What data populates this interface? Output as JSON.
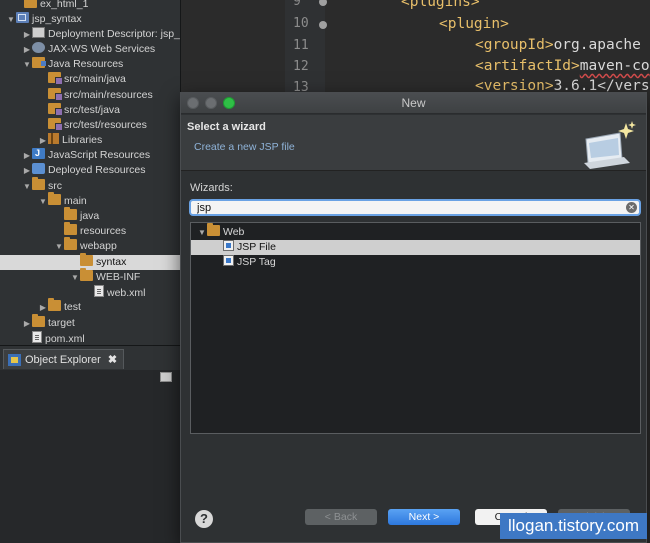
{
  "project_tree": [
    {
      "label": "ex_html_1",
      "icon": "project-icon",
      "arrow": ""
    },
    {
      "label": "jsp_syntax",
      "icon": "project-icon",
      "arrow": "▼"
    },
    {
      "label": "Deployment Descriptor: jsp_syntax",
      "icon": "deployment-descriptor-icon",
      "arrow": "▶"
    },
    {
      "label": "JAX-WS Web Services",
      "icon": "web-services-icon",
      "arrow": "▶"
    },
    {
      "label": "Java Resources",
      "icon": "java-resources-icon",
      "arrow": "▼"
    },
    {
      "label": "src/main/java",
      "icon": "source-folder-icon",
      "arrow": ""
    },
    {
      "label": "src/main/resources",
      "icon": "source-folder-icon",
      "arrow": ""
    },
    {
      "label": "src/test/java",
      "icon": "source-folder-icon",
      "arrow": ""
    },
    {
      "label": "src/test/resources",
      "icon": "source-folder-icon",
      "arrow": ""
    },
    {
      "label": "Libraries",
      "icon": "libraries-icon",
      "arrow": "▶"
    },
    {
      "label": "JavaScript Resources",
      "icon": "javascript-resources-icon",
      "arrow": "▶"
    },
    {
      "label": "Deployed Resources",
      "icon": "deployed-resources-icon",
      "arrow": "▶"
    },
    {
      "label": "src",
      "icon": "folder-icon",
      "arrow": "▼"
    },
    {
      "label": "main",
      "icon": "folder-icon",
      "arrow": "▼"
    },
    {
      "label": "java",
      "icon": "folder-icon",
      "arrow": ""
    },
    {
      "label": "resources",
      "icon": "folder-icon",
      "arrow": ""
    },
    {
      "label": "webapp",
      "icon": "folder-icon",
      "arrow": "▼"
    },
    {
      "label": "syntax",
      "icon": "folder-icon",
      "arrow": ""
    },
    {
      "label": "WEB-INF",
      "icon": "folder-icon",
      "arrow": "▼"
    },
    {
      "label": "web.xml",
      "icon": "xml-file-icon",
      "arrow": ""
    },
    {
      "label": "test",
      "icon": "folder-icon",
      "arrow": "▶"
    },
    {
      "label": "target",
      "icon": "folder-icon",
      "arrow": "▶"
    },
    {
      "label": "pom.xml",
      "icon": "xml-file-icon",
      "arrow": ""
    }
  ],
  "object_explorer": {
    "tab_label": "Object Explorer",
    "close_glyph": "✖"
  },
  "editor": {
    "line_numbers": [
      "9",
      "10",
      "11",
      "12",
      "13"
    ],
    "code_lines": [
      {
        "tag": "<plugins>",
        "text": ""
      },
      {
        "tag": "<plugin>",
        "text": ""
      },
      {
        "tag": "<groupId>",
        "text": "org.apache"
      },
      {
        "tag": "<artifactId>",
        "text": "maven-co"
      },
      {
        "tag": "<version>",
        "text": "3.6.1</vers"
      }
    ]
  },
  "dialog": {
    "title": "New",
    "banner_title": "Select a wizard",
    "banner_subtitle": "Create a new JSP file",
    "wizards_label": "Wizards:",
    "filter_value": "jsp",
    "clear_glyph": "✕",
    "tree": [
      {
        "label": "Web",
        "arrow": "▼",
        "icon": "folder-icon"
      },
      {
        "label": "JSP File",
        "arrow": "",
        "icon": "jsp-file-icon"
      },
      {
        "label": "JSP Tag",
        "arrow": "",
        "icon": "jsp-tag-icon"
      }
    ],
    "help_glyph": "?",
    "back_label": "< Back",
    "next_label": "Next >",
    "cancel_label": "Cancel",
    "finish_label": "Finish"
  },
  "watermark": "llogan.tistory.com",
  "colors": {
    "accent": "#2d78de",
    "selection": "#cfcfcf",
    "watermark": "#3e78c4"
  }
}
